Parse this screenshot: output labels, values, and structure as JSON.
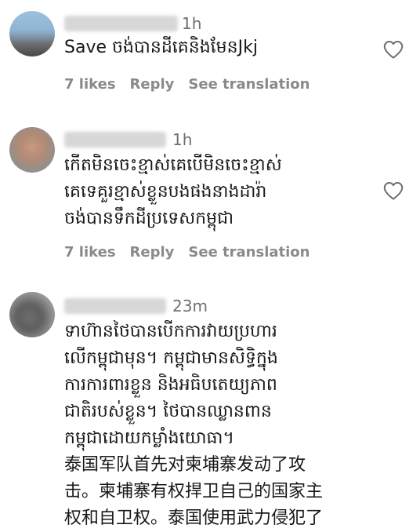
{
  "comments": [
    {
      "time": "1h",
      "text": "Save ចង់បានដីគេនិងមែនJkj",
      "likes": "7 likes",
      "reply": "Reply",
      "translate": "See translation"
    },
    {
      "time": "1h",
      "text": "កើតមិនចេះខ្មាស់គេបើមិនចេះខ្មាស់\nគេទេគួរខ្មាស់ខ្លួនបងផងនាងដារ៉ា\nចង់បានទឹកដីប្រទេសកម្ពុជា",
      "likes": "7 likes",
      "reply": "Reply",
      "translate": "See translation"
    },
    {
      "time": "23m",
      "text": "ទាហ៊ានថៃបានបើកការវាយប្រហារ\nលើកម្ពុជាមុន។ កម្ពុជាមានសិទ្ធិក្នុង\nការការពារខ្លួន និងអធិបតេយ្យភាព\nជាតិរបស់ខ្លួន។ ថៃបានឈ្លានពាន\nកម្ពុជាដោយកម្លាំងយោធា។\n泰国军队首先对柬埔寨发动了攻\n击。柬埔寨有权捍卫自己的国家主\n权和自卫权。泰国使用武力侵犯了"
    }
  ],
  "icons": {
    "like": "heart-outline-icon"
  }
}
